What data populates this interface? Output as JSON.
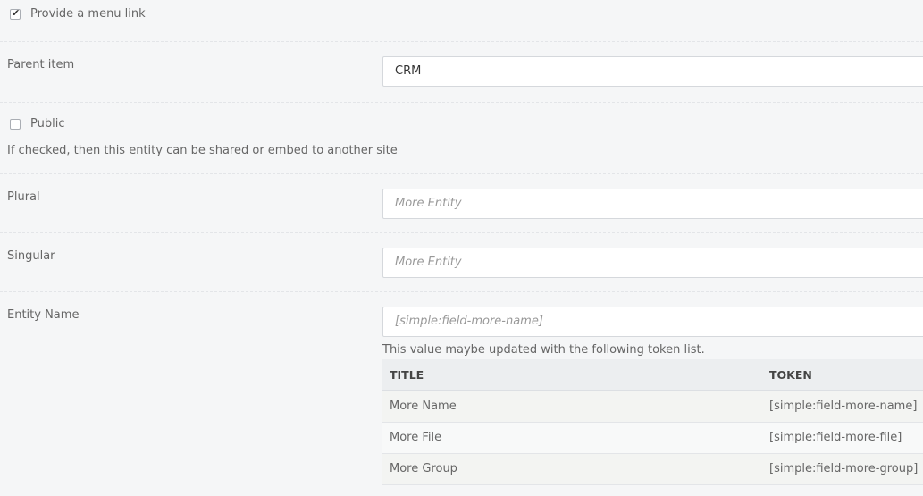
{
  "menu_link": {
    "label": "Provide a menu link",
    "checked": true
  },
  "parent_item": {
    "label": "Parent item",
    "value": "CRM"
  },
  "public": {
    "label": "Public",
    "checked": false,
    "help": "If checked, then this entity can be shared or embed to another site"
  },
  "plural": {
    "label": "Plural",
    "placeholder": "More Entity"
  },
  "singular": {
    "label": "Singular",
    "placeholder": "More Entity"
  },
  "entity_name": {
    "label": "Entity Name",
    "placeholder": "[simple:field-more-name]",
    "help": "This value maybe updated with the following token list."
  },
  "token_table": {
    "headers": {
      "title": "TITLE",
      "token": "TOKEN"
    },
    "rows": [
      {
        "title": "More Name",
        "token": "[simple:field-more-name]"
      },
      {
        "title": "More File",
        "token": "[simple:field-more-file]"
      },
      {
        "title": "More Group",
        "token": "[simple:field-more-group]"
      }
    ]
  }
}
